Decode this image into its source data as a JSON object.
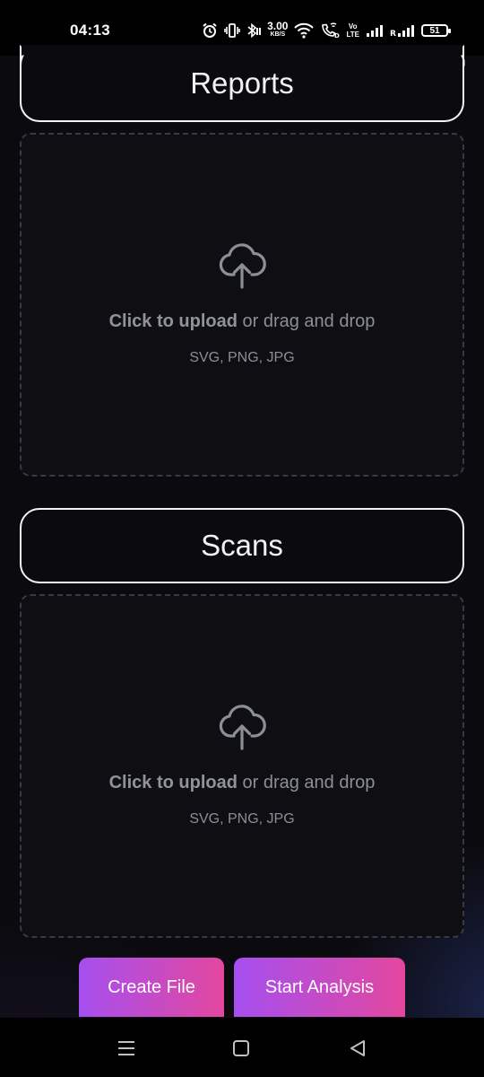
{
  "status_bar": {
    "time": "04:13",
    "net_speed_value": "3.00",
    "net_speed_unit": "KB/S",
    "volte_top": "Vo",
    "volte_bottom": "LTE",
    "battery": "51",
    "icons": [
      "alarm-icon",
      "vibrate-icon",
      "bluetooth-icon",
      "wifi-icon",
      "wifi-calling-icon",
      "signal-icon",
      "roaming-signal-icon",
      "battery-icon"
    ]
  },
  "sections": [
    {
      "title": "Reports",
      "upload": {
        "action_strong": "Click to upload",
        "action_rest": " or drag and drop",
        "formats": "SVG, PNG, JPG"
      }
    },
    {
      "title": "Scans",
      "upload": {
        "action_strong": "Click to upload",
        "action_rest": " or drag and drop",
        "formats": "SVG, PNG, JPG"
      }
    }
  ],
  "actions": {
    "create_label": "Create File",
    "start_label": "Start Analysis"
  },
  "nav": {
    "items": [
      "menu-icon",
      "home-icon",
      "back-icon"
    ]
  },
  "colors": {
    "background": "#0b0a0e",
    "button_gradient_start": "#a64ff0",
    "button_gradient_end": "#e3479e",
    "muted_text": "#8b8f98"
  }
}
